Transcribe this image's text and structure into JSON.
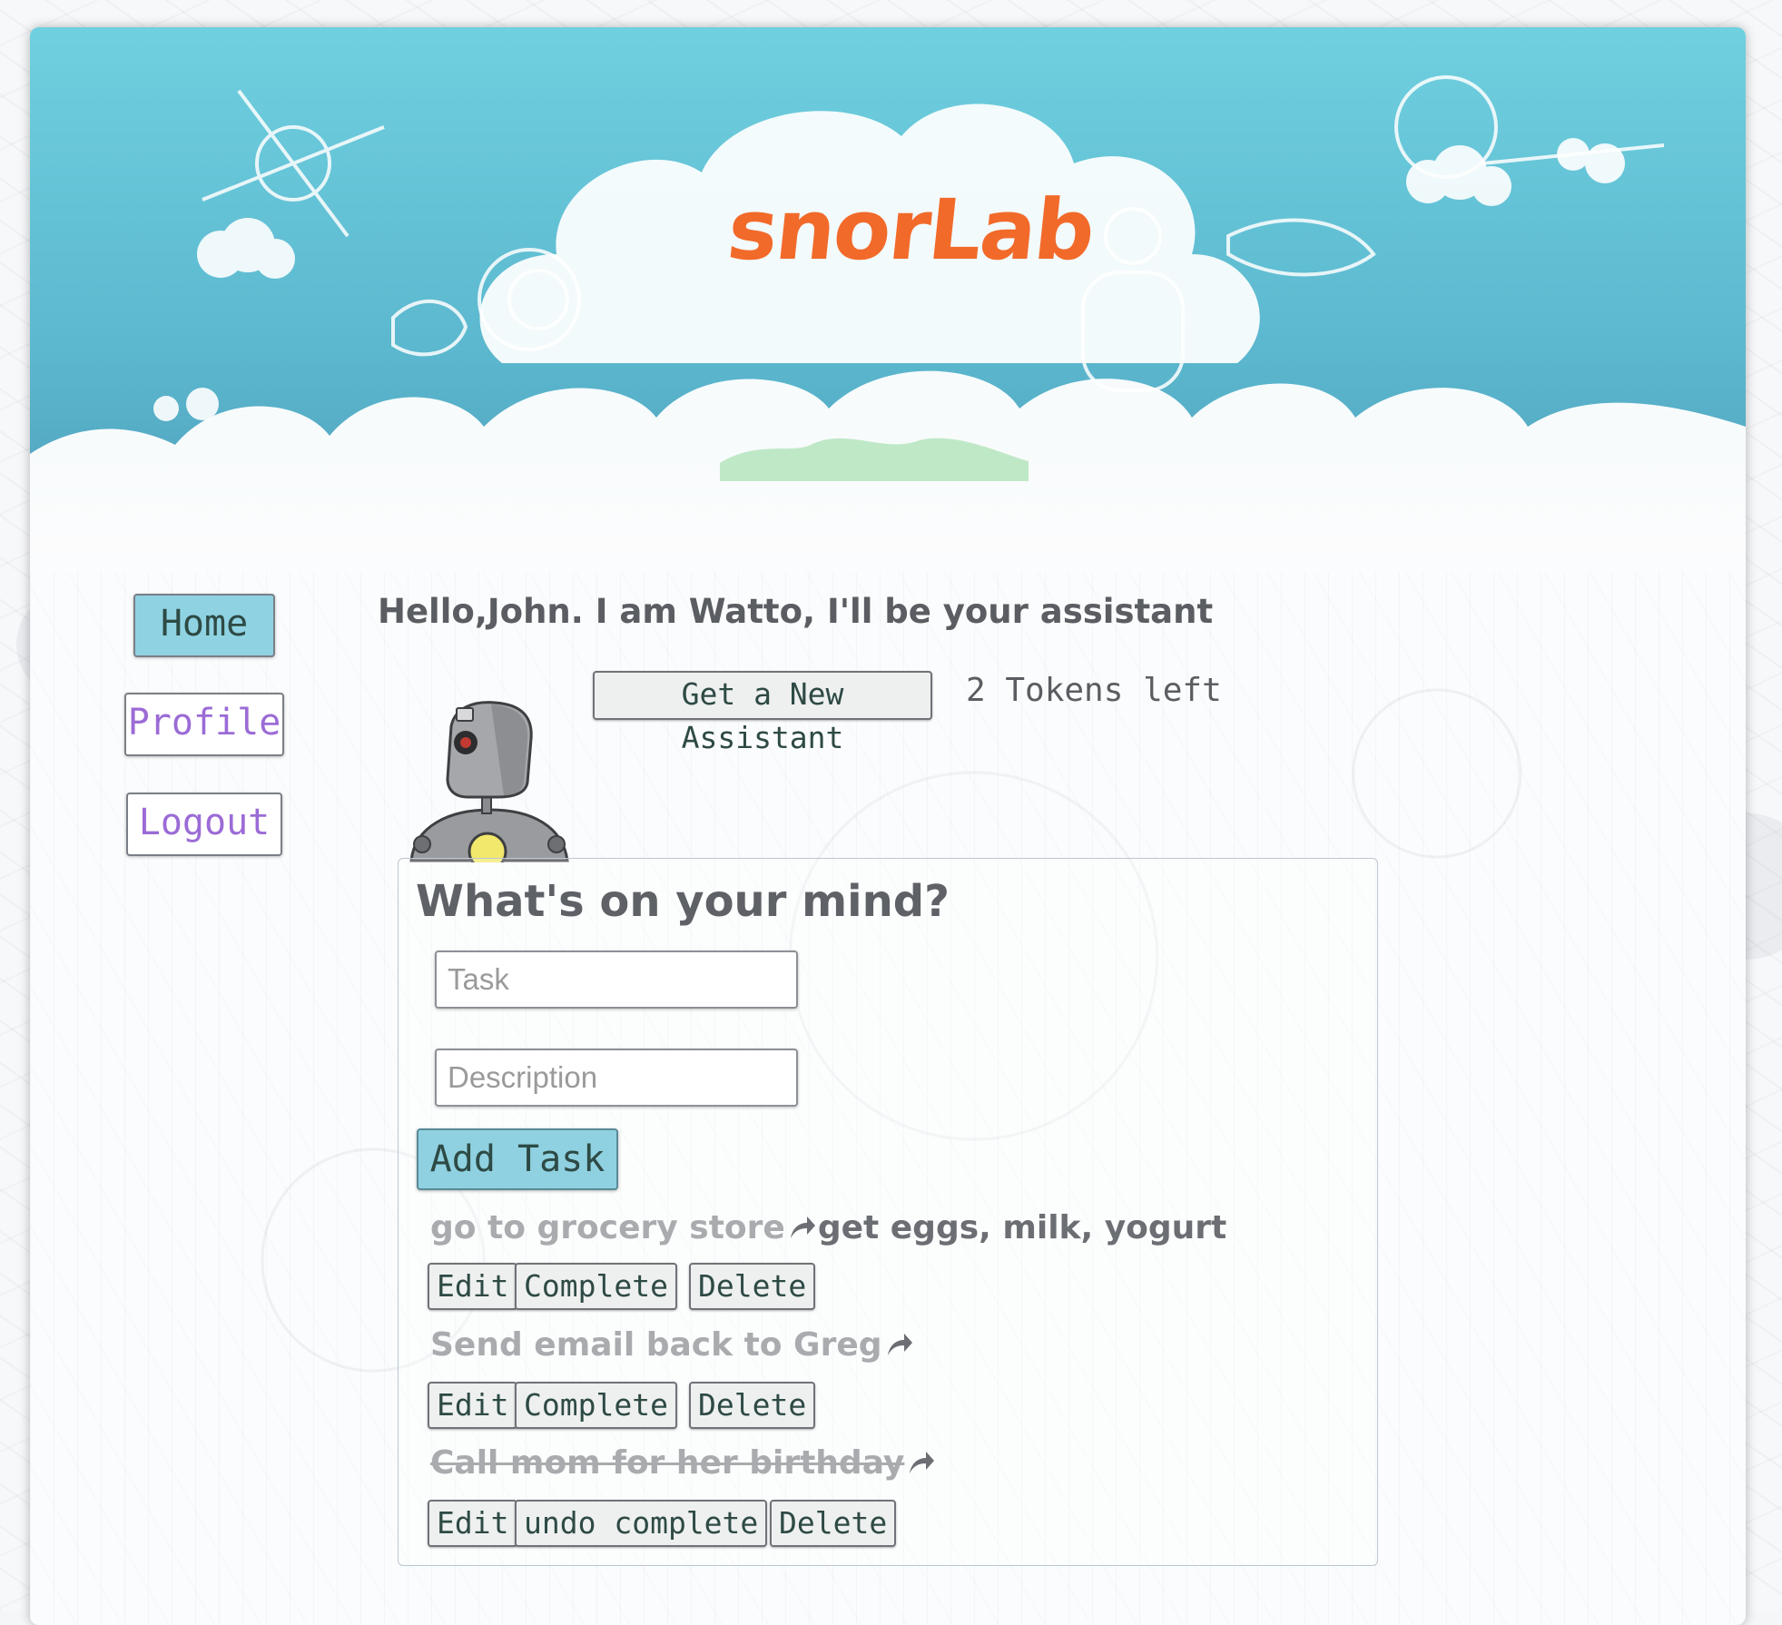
{
  "header": {
    "brand": "snorLab"
  },
  "nav": [
    {
      "label": "Home",
      "active": true
    },
    {
      "label": "Profile",
      "active": false
    },
    {
      "label": "Logout",
      "active": false
    }
  ],
  "greeting": "Hello,John. I am Watto, I'll be your assistant",
  "assistant": {
    "new_button": "Get a New Assistant",
    "tokens": "2 Tokens left"
  },
  "form": {
    "title": "What's on your mind?",
    "task_placeholder": "Task",
    "description_placeholder": "Description",
    "add_button": "Add Task"
  },
  "tasks": [
    {
      "title": "go to grocery store",
      "description": "get eggs, milk, yogurt",
      "completed": false,
      "edit": "Edit",
      "complete": "Complete",
      "delete": "Delete"
    },
    {
      "title": "Send email back to Greg",
      "description": "",
      "completed": false,
      "edit": "Edit",
      "complete": "Complete",
      "delete": "Delete"
    },
    {
      "title": "Call mom for her birthday",
      "description": "",
      "completed": true,
      "edit": "Edit",
      "complete": "undo complete",
      "delete": "Delete"
    }
  ],
  "colors": {
    "brand": "#f26a2a",
    "sky": "#6fd0df",
    "nav_active_bg": "#8fd3e3",
    "nav_inactive_text": "#9b6bd6",
    "button_text": "#2e4a45"
  },
  "icons": {
    "task_link": "share-arrow-icon"
  }
}
